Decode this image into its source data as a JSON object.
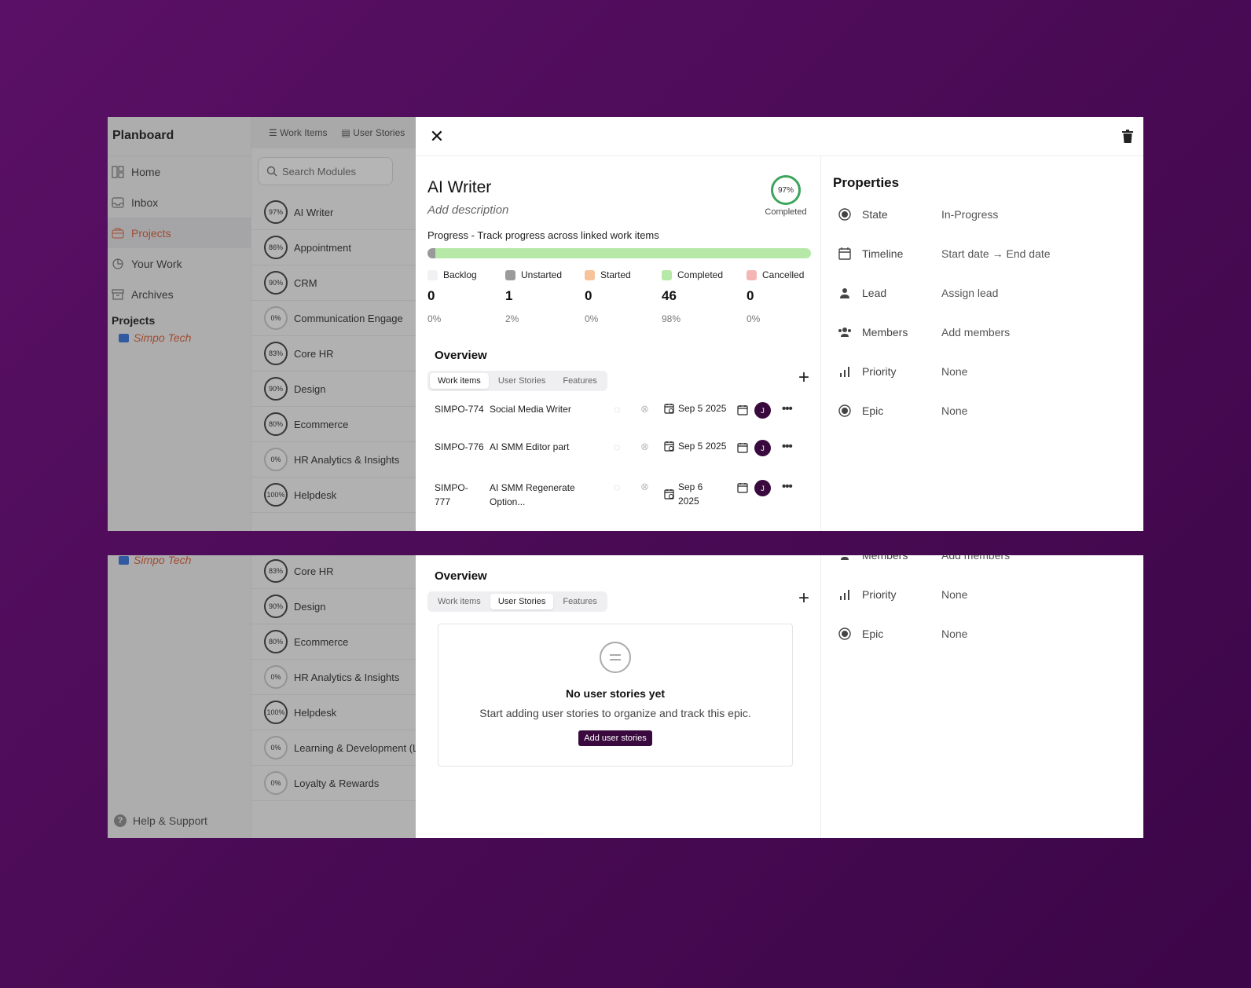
{
  "app": {
    "brand": "Planboard",
    "nav": [
      {
        "label": "Home",
        "icon": "layout-icon"
      },
      {
        "label": "Inbox",
        "icon": "inbox-icon"
      },
      {
        "label": "Projects",
        "icon": "briefcase-icon",
        "active": true
      },
      {
        "label": "Your Work",
        "icon": "chart-icon"
      },
      {
        "label": "Archives",
        "icon": "archive-icon"
      }
    ],
    "projects_label": "Projects",
    "project_name": "Simpo Tech",
    "help_label": "Help & Support",
    "tabs": [
      "Work Items",
      "User Stories"
    ],
    "search_placeholder": "Search Modules",
    "modules_top": [
      {
        "pct": "97%",
        "name": "AI Writer"
      },
      {
        "pct": "86%",
        "name": "Appointment"
      },
      {
        "pct": "90%",
        "name": "CRM"
      },
      {
        "pct": "0%",
        "name": "Communication Engage"
      },
      {
        "pct": "83%",
        "name": "Core HR"
      },
      {
        "pct": "90%",
        "name": "Design"
      },
      {
        "pct": "80%",
        "name": "Ecommerce"
      },
      {
        "pct": "0%",
        "name": "HR Analytics & Insights"
      },
      {
        "pct": "100%",
        "name": "Helpdesk"
      }
    ],
    "modules_bottom": [
      {
        "pct": "83%",
        "name": "Core HR"
      },
      {
        "pct": "90%",
        "name": "Design"
      },
      {
        "pct": "80%",
        "name": "Ecommerce"
      },
      {
        "pct": "0%",
        "name": "HR Analytics & Insights"
      },
      {
        "pct": "100%",
        "name": "Helpdesk"
      },
      {
        "pct": "0%",
        "name": "Learning & Development (L"
      },
      {
        "pct": "0%",
        "name": "Loyalty & Rewards"
      }
    ]
  },
  "modal": {
    "title": "AI Writer",
    "description_placeholder": "Add description",
    "completion_pct": "97%",
    "completion_label": "Completed",
    "progress_label": "Progress - Track progress across linked work items",
    "progress_fraction": 0.98,
    "stats": [
      {
        "label": "Backlog",
        "count": "0",
        "pct": "0%",
        "color": "#f1f1f4"
      },
      {
        "label": "Unstarted",
        "count": "1",
        "pct": "2%",
        "color": "#9b9b9b"
      },
      {
        "label": "Started",
        "count": "0",
        "pct": "0%",
        "color": "#f6c39a"
      },
      {
        "label": "Completed",
        "count": "46",
        "pct": "98%",
        "color": "#b6e8a8"
      },
      {
        "label": "Cancelled",
        "count": "0",
        "pct": "0%",
        "color": "#f5b5b5"
      }
    ],
    "overview_title": "Overview",
    "overview_tabs": [
      "Work items",
      "User Stories",
      "Features"
    ],
    "work_items": [
      {
        "id": "SIMPO-774",
        "name": "Social Media Writer",
        "date": "Sep 5 2025",
        "assignee": "J"
      },
      {
        "id": "SIMPO-776",
        "name": "AI SMM Editor part",
        "date": "Sep 5 2025",
        "assignee": "J"
      },
      {
        "id": "SIMPO-777",
        "name": "AI SMM Regenerate Option...",
        "date": "Sep 6 2025",
        "assignee": "J"
      }
    ],
    "empty_state": {
      "title": "No user stories yet",
      "subtitle": "Start adding user stories to organize and track this epic.",
      "button": "Add user stories"
    },
    "properties_title": "Properties",
    "properties": [
      {
        "key": "State",
        "value": "In-Progress",
        "icon": "state-icon"
      },
      {
        "key": "Timeline",
        "value": "Start date → End date",
        "icon": "calendar-icon"
      },
      {
        "key": "Lead",
        "value": "Assign lead",
        "icon": "person-icon"
      },
      {
        "key": "Members",
        "value": "Add members",
        "icon": "members-icon"
      },
      {
        "key": "Priority",
        "value": "None",
        "icon": "priority-icon"
      },
      {
        "key": "Epic",
        "value": "None",
        "icon": "epic-icon"
      }
    ],
    "accent_color": "#3a0a3f",
    "completion_color": "#3ba55c"
  }
}
